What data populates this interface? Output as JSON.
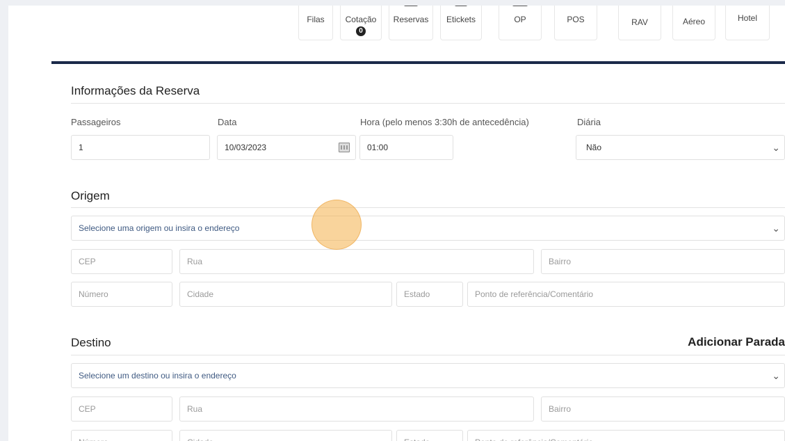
{
  "nav": {
    "items": [
      {
        "label": "Filas"
      },
      {
        "label": "Cotação",
        "badge": "0"
      },
      {
        "label": "Reservas"
      },
      {
        "label": "Etickets"
      },
      {
        "label": "OP"
      },
      {
        "label": "POS"
      },
      {
        "label": "RAV"
      },
      {
        "label": "Aéreo"
      },
      {
        "label": "Hotel"
      }
    ]
  },
  "reserva": {
    "title": "Informações da Reserva",
    "passageiros_label": "Passageiros",
    "passageiros_value": "1",
    "data_label": "Data",
    "data_value": "10/03/2023",
    "hora_label": "Hora (pelo menos 3:30h de antecedência)",
    "hora_value": "01:00",
    "diaria_label": "Diária",
    "diaria_value": "Não"
  },
  "origem": {
    "title": "Origem",
    "select_placeholder": "Selecione uma origem ou insira o endereço",
    "cep": "CEP",
    "rua": "Rua",
    "bairro": "Bairro",
    "numero": "Número",
    "cidade": "Cidade",
    "estado": "Estado",
    "referencia": "Ponto de referência/Comentário"
  },
  "destino": {
    "title": "Destino",
    "add_stop": "Adicionar Parada",
    "select_placeholder": "Selecione um destino ou insira o endereço",
    "cep": "CEP",
    "rua": "Rua",
    "bairro": "Bairro",
    "numero": "Número",
    "cidade": "Cidade",
    "estado": "Estado",
    "referencia": "Ponto de referência/Comentário"
  },
  "icons": {
    "chevron": "chevron-down-icon",
    "calendar": "calendar-icon"
  }
}
